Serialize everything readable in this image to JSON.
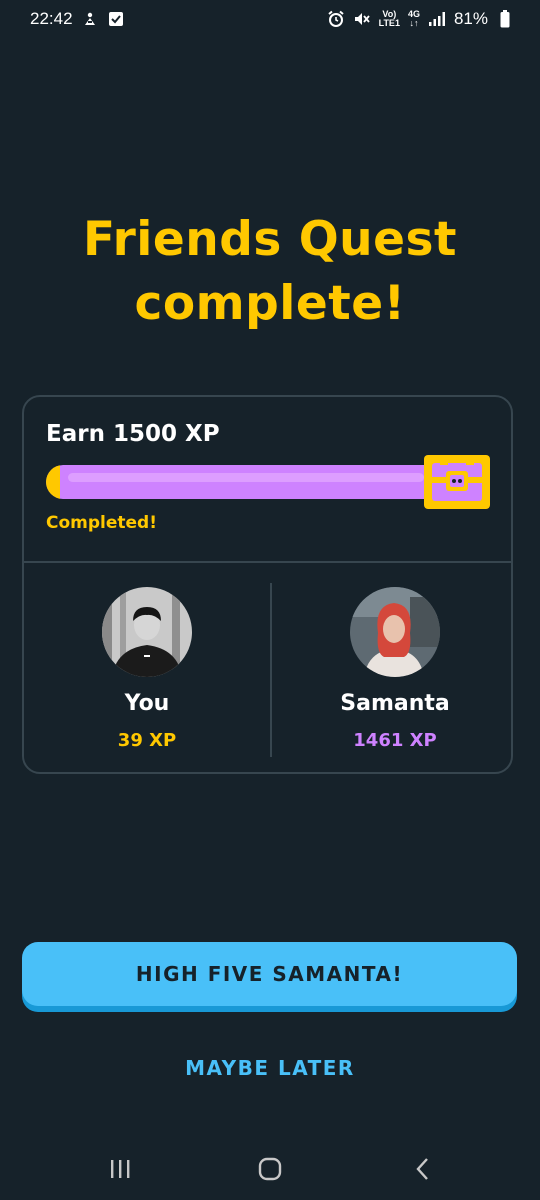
{
  "status_bar": {
    "time": "22:42",
    "battery": "81%",
    "network_top": "Vo)",
    "network_bottom": "LTE1",
    "network_gen": "4G",
    "icons": [
      "bixby-icon",
      "checkbox-notification-icon",
      "alarm-icon",
      "muted-icon",
      "signal-icon",
      "battery-icon"
    ]
  },
  "title": {
    "line1": "Friends Quest",
    "line2": "complete!"
  },
  "quest": {
    "goal": "Earn 1500 XP",
    "progress": 1.0,
    "status": "Completed!",
    "reward_icon": "treasure-chest-icon"
  },
  "participants": [
    {
      "name": "You",
      "xp": "39 XP",
      "avatar": "avatar-photo"
    },
    {
      "name": "Samanta",
      "xp": "1461 XP",
      "avatar": "avatar-photo"
    }
  ],
  "actions": {
    "primary": "HIGH FIVE SAMANTA!",
    "secondary": "MAYBE LATER"
  },
  "nav": {
    "icons": [
      "recent-apps-icon",
      "home-icon",
      "back-icon"
    ]
  },
  "colors": {
    "background": "#16222a",
    "accent_yellow": "#ffc800",
    "accent_purple": "#ce82ff",
    "button_blue": "#49c0f8",
    "border": "#37464f"
  }
}
